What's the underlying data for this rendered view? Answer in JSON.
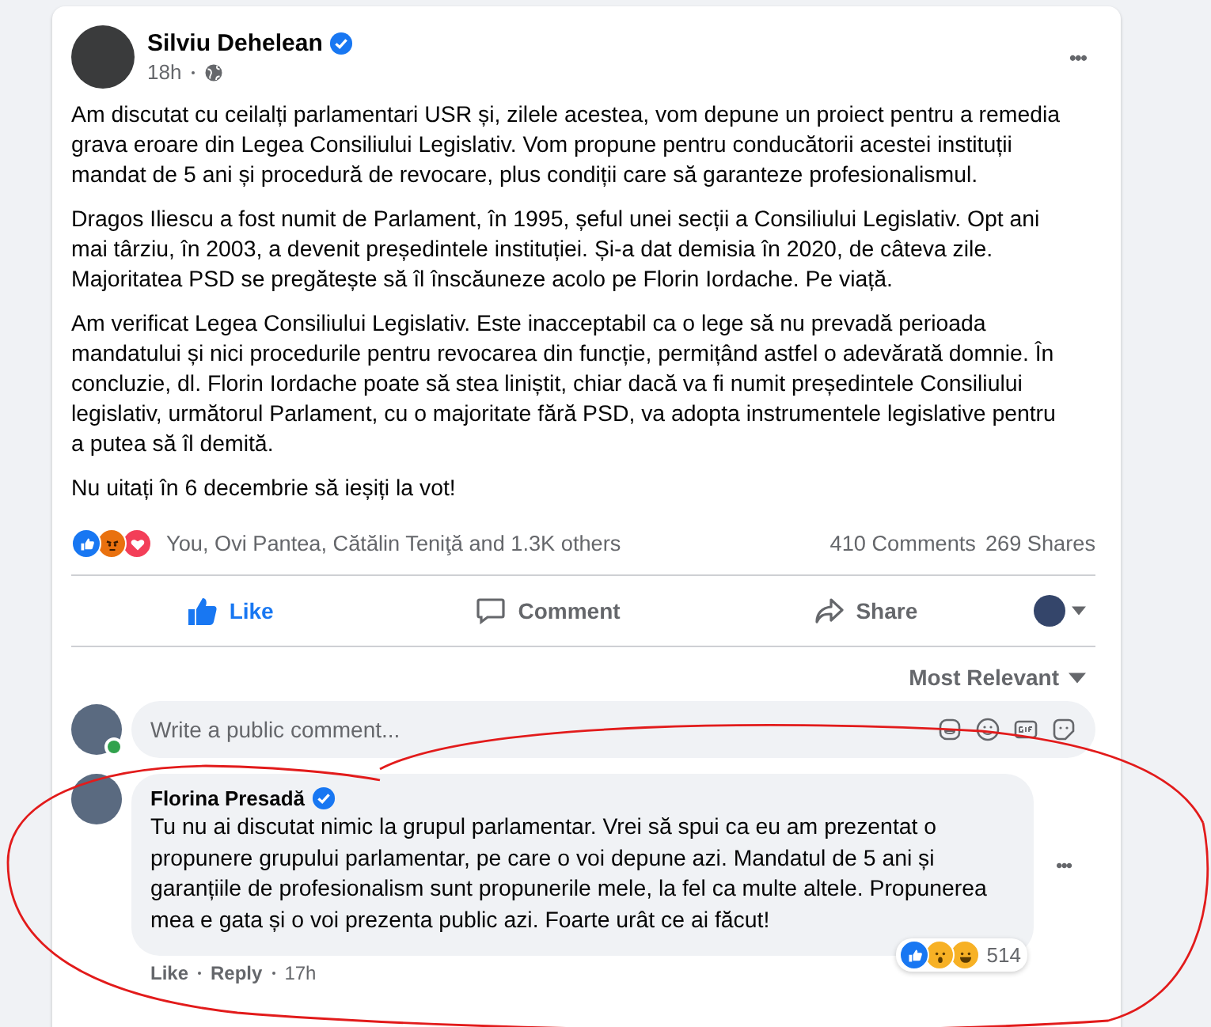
{
  "post": {
    "author": "Silviu Dehelean",
    "verified": true,
    "time": "18h",
    "more": "•••",
    "paragraphs": [
      "Am discutat cu ceilalți parlamentari USR și, zilele acestea, vom depune un proiect pentru a remedia grava eroare din Legea Consiliului Legislativ. Vom propune pentru conducătorii acestei instituții mandat de 5 ani și procedură de revocare, plus condiții care să garanteze profesionalismul.",
      "Dragos Iliescu a fost numit de Parlament, în 1995, șeful unei secții a Consiliului Legislativ.  Opt ani mai târziu, în 2003, a devenit președintele instituției. Și-a dat demisia în 2020, de câteva zile. Majoritatea PSD se pregătește să îl înscăuneze acolo pe Florin Iordache. Pe viață.",
      "Am verificat Legea Consiliului Legislativ. Este inacceptabil ca o lege să nu prevadă perioada mandatului și nici procedurile pentru revocarea din funcție, permițând astfel o adevărată domnie. În concluzie, dl. Florin Iordache poate să stea liniștit, chiar dacă va fi numit președintele Consiliului legislativ, următorul Parlament, cu o majoritate fără PSD, va adopta instrumentele legislative pentru a putea să îl demită.",
      "Nu uitați în 6 decembrie să ieșiți la vot!"
    ],
    "reactions": [
      {
        "kind": "like"
      },
      {
        "kind": "angry"
      },
      {
        "kind": "love"
      }
    ],
    "reactors": "You, Ovi Pantea, Cătălin Teniţă and 1.3K others",
    "comments_count": "410 Comments",
    "shares_count": "269 Shares",
    "actions": [
      {
        "kind": "like",
        "label": "Like",
        "active": true
      },
      {
        "kind": "comment",
        "label": "Comment",
        "active": false
      },
      {
        "kind": "share",
        "label": "Share",
        "active": false
      }
    ]
  },
  "comments": {
    "sort": "Most Relevant",
    "input": {
      "placeholder": "Write a public comment..."
    },
    "items": [
      {
        "author": "Florina Presadă",
        "verified": true,
        "text": "Tu nu ai discutat nimic la grupul parlamentar. Vrei să spui ca eu am prezentat o propunere grupului parlamentar, pe care o voi depune azi. Mandatul de 5 ani și garanțiile de profesionalism sunt propunerile mele, la fel ca multe altele. Propunerea mea e gata și o voi prezenta public azi. Foarte urât ce ai făcut!",
        "reactions": [
          {
            "kind": "like"
          },
          {
            "kind": "wow"
          },
          {
            "kind": "haha"
          }
        ],
        "reaction_count": "514",
        "like": "Like",
        "reply": "Reply",
        "time": "17h",
        "more": "•••"
      }
    ]
  }
}
